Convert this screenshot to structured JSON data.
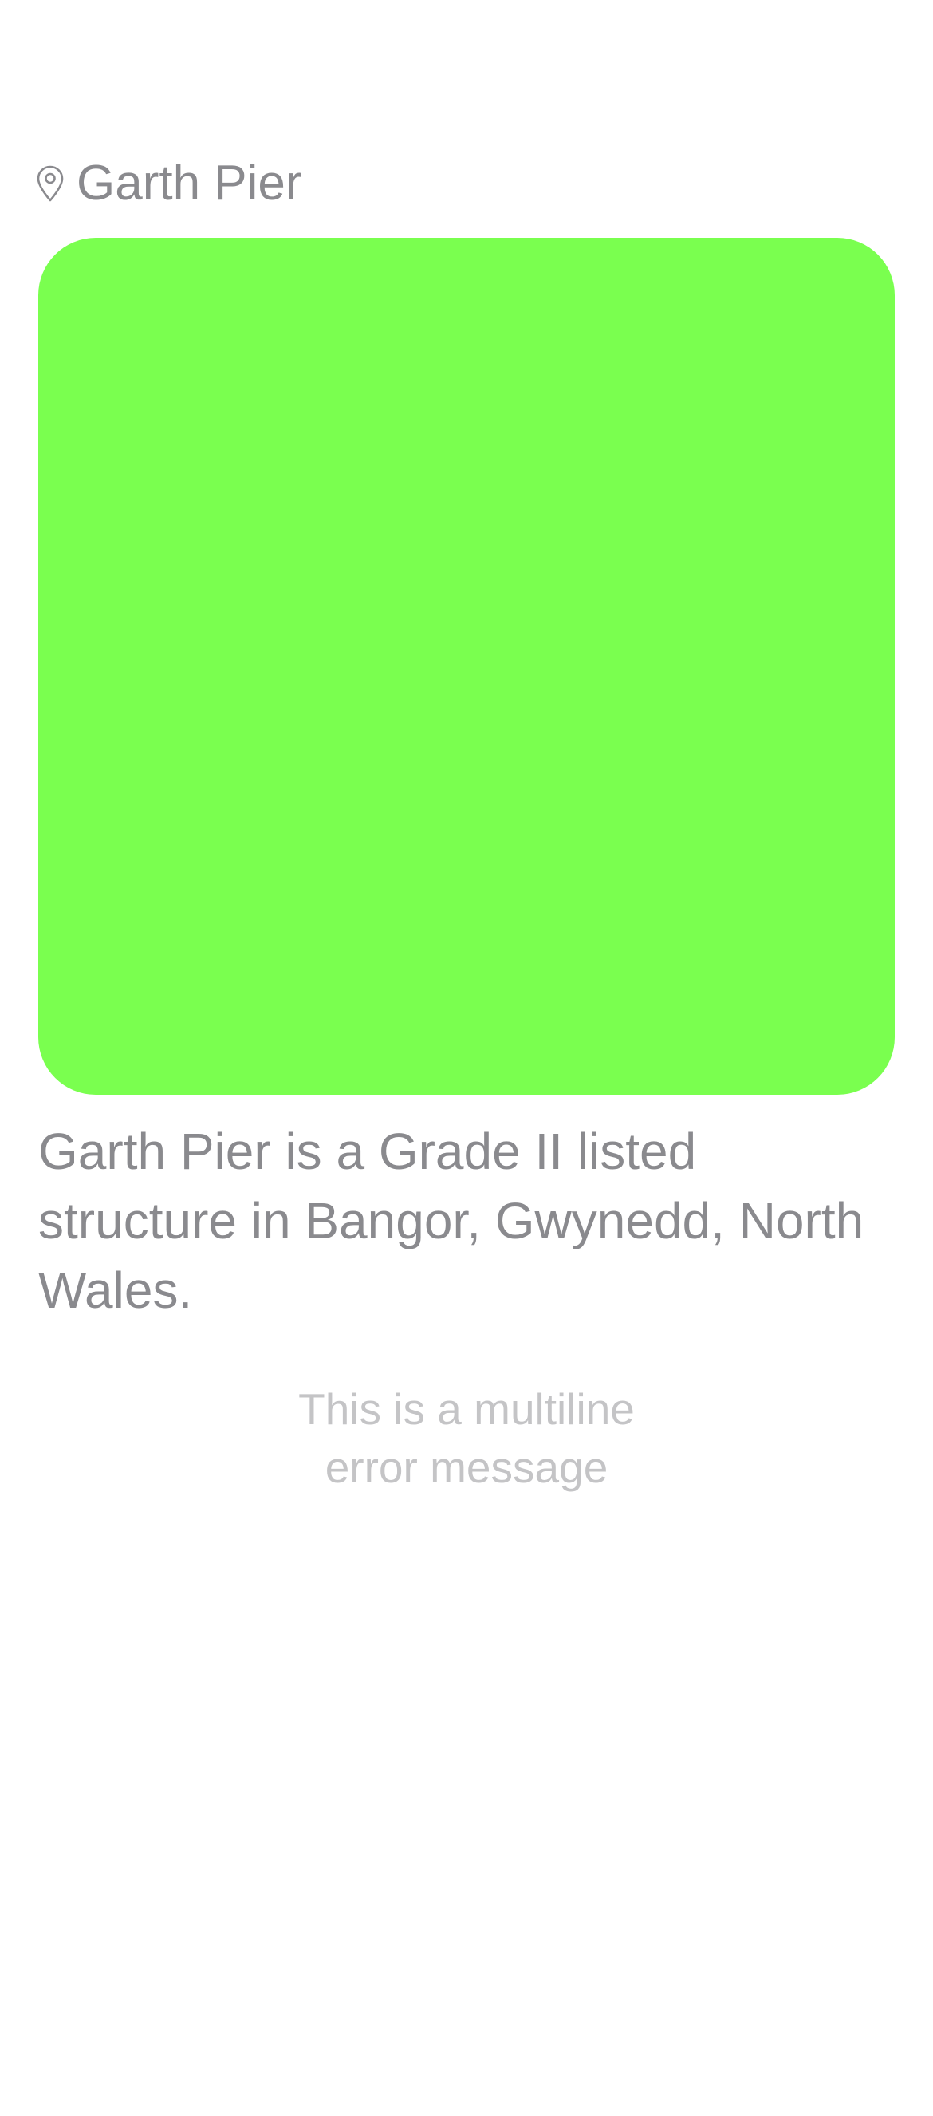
{
  "header": {
    "location_icon": "map-pin-icon",
    "location_name": "Garth Pier"
  },
  "image_card": {
    "color": "#7AFF4F"
  },
  "description": "Garth Pier is a Grade II listed structure in Bangor, Gwynedd, North Wales.",
  "error": {
    "line1": "This is a multiline",
    "line2": "error message"
  },
  "colors": {
    "text_primary": "#8A8A8E",
    "text_secondary": "#C4C4C6",
    "background": "#FFFFFF"
  }
}
